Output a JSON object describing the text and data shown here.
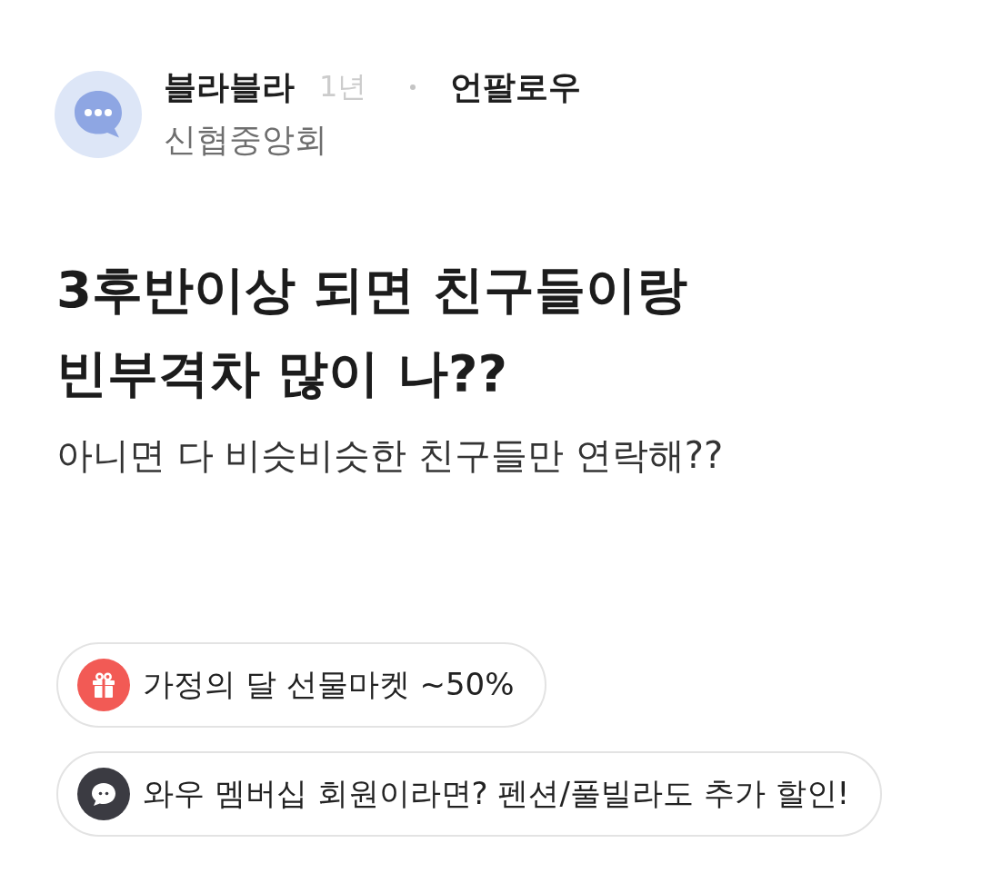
{
  "post": {
    "author": {
      "name": "블라블라",
      "time": "1년",
      "follow_label": "언팔로우",
      "company": "신협중앙회"
    },
    "title": "3후반이상 되면 친구들이랑 빈부격차 많이 나??",
    "body": "아니면 다 비슷비슷한 친구들만 연락해??"
  },
  "promos": [
    {
      "kind": "gift",
      "text": "가정의 달 선물마켓 ~50%"
    },
    {
      "kind": "chat",
      "text": "와우 멤버십 회원이라면? 펜션/풀빌라도 추가 할인!"
    }
  ]
}
